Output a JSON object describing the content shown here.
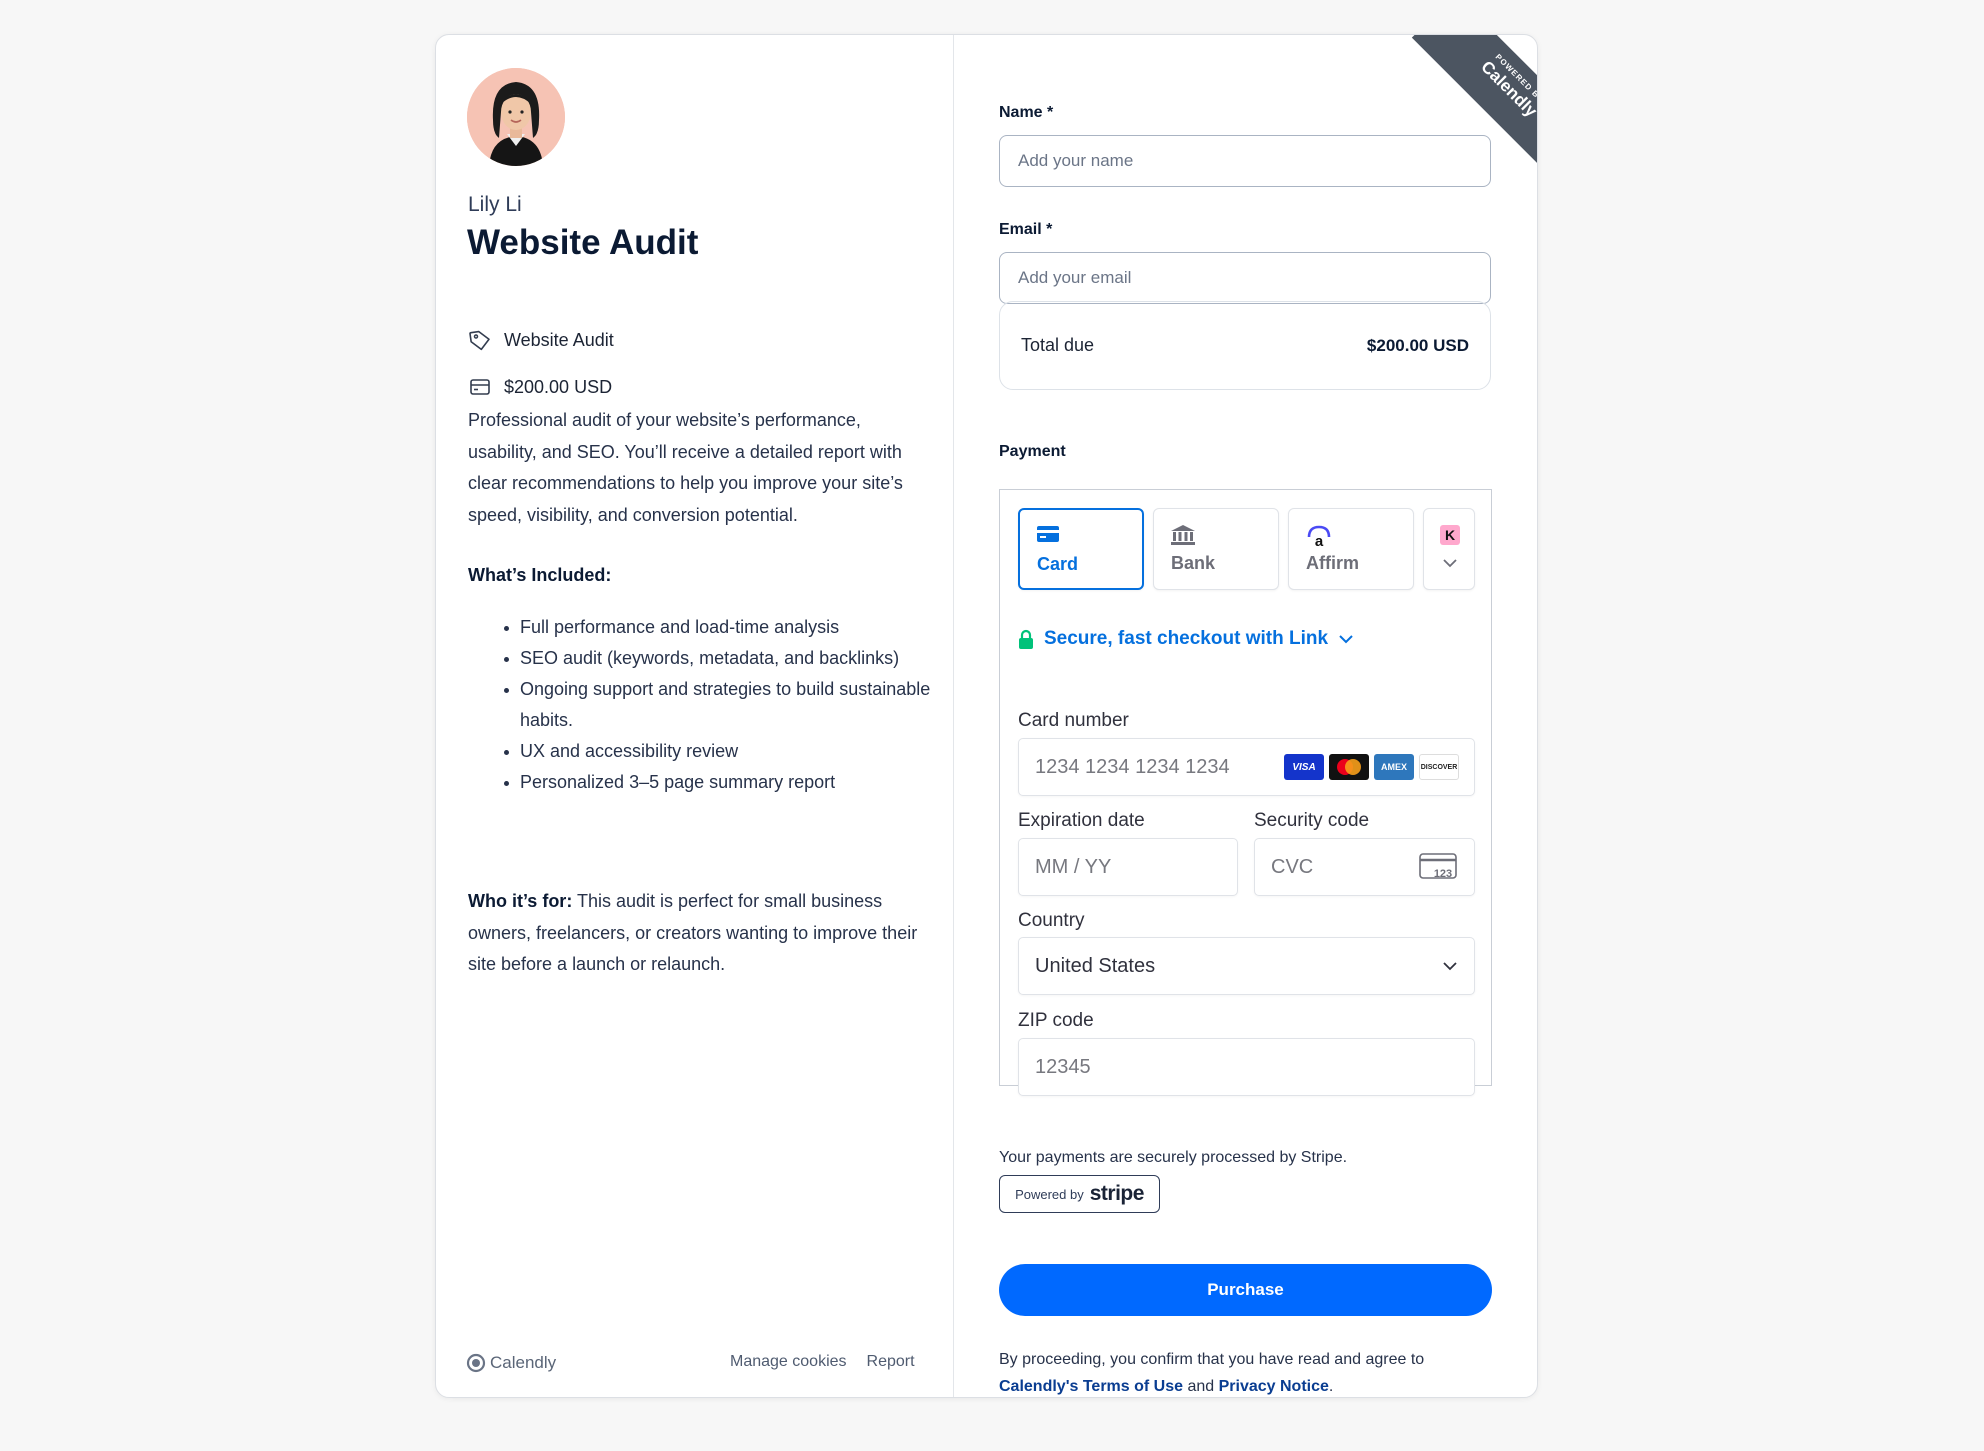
{
  "host": {
    "name": "Lily Li"
  },
  "event": {
    "title": "Website Audit",
    "tag_label": "Website Audit",
    "price_label": "$200.00 USD",
    "description": "Professional audit of your website’s performance, usability, and SEO. You’ll receive a detailed report with clear recommendations to help you improve your site’s speed, visibility, and conversion potential.",
    "included_title": "What’s Included:",
    "included_items": [
      "Full performance and load-time analysis",
      "SEO audit (keywords, metadata, and backlinks)",
      "Ongoing support and strategies to build sustainable habits.",
      "UX and accessibility review",
      "Personalized 3–5 page summary report"
    ],
    "who_label": "Who it’s for:",
    "who_text": " This audit is perfect for small business owners, freelancers, or creators wanting to improve their site before a launch or relaunch."
  },
  "footer": {
    "brand": "Calendly",
    "manage_cookies": "Manage cookies",
    "report": "Report"
  },
  "ribbon": {
    "small": "POWERED BY",
    "big": "Calendly"
  },
  "form": {
    "name_label": "Name",
    "name_placeholder": "Add your name",
    "email_label": "Email",
    "email_placeholder": "Add your email",
    "required_mark": " *",
    "total_label": "Total due",
    "total_value": "$200.00 USD",
    "payment_label": "Payment"
  },
  "payment": {
    "tabs": [
      {
        "label": "Card",
        "icon": "card-icon",
        "active": true
      },
      {
        "label": "Bank",
        "icon": "bank-icon",
        "active": false
      },
      {
        "label": "Affirm",
        "icon": "affirm-icon",
        "active": false
      }
    ],
    "more_icon": "klarna-icon",
    "link_text": "Secure, fast checkout with Link",
    "card_number_label": "Card number",
    "card_number_placeholder": "1234 1234 1234 1234",
    "card_brands": [
      "VISA",
      "mastercard",
      "AMEX",
      "DISCOVER"
    ],
    "expiration_label": "Expiration date",
    "expiration_placeholder": "MM / YY",
    "security_label": "Security code",
    "security_placeholder": "CVC",
    "cvc_icon_text": "123",
    "country_label": "Country",
    "country_value": "United States",
    "zip_label": "ZIP code",
    "zip_placeholder": "12345",
    "accent_color": "#0570de"
  },
  "stripe": {
    "note": "Your payments are securely processed by Stripe.",
    "powered_by": "Powered by",
    "brand": "stripe"
  },
  "purchase_label": "Purchase",
  "legal": {
    "prefix": "By proceeding, you confirm that you have read and agree to ",
    "terms": "Calendly's Terms of Use",
    "and": " and ",
    "privacy": "Privacy Notice",
    "suffix": "."
  },
  "colors": {
    "primary_button": "#0069ff",
    "ribbon": "#4c5561",
    "title": "#0b1a33"
  }
}
